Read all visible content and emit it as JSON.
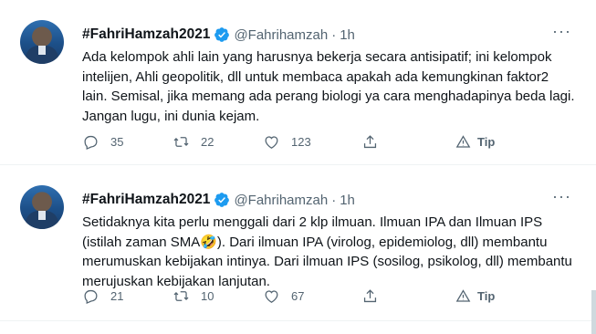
{
  "tweets": [
    {
      "display_name": "#FahriHamzah2021",
      "handle": "@Fahrihamzah",
      "separator": "·",
      "time": "1h",
      "more": "···",
      "text": "Ada kelompok ahli lain yang harusnya bekerja secara antisipatif; ini kelompok intelijen, Ahli geopolitik, dll untuk membaca apakah ada kemungkinan faktor2 lain. Semisal, jika memang ada perang biologi ya cara menghadapinya beda lagi. Jangan lugu, ini dunia kejam.",
      "replies": "35",
      "retweets": "22",
      "likes": "123",
      "tip_label": "Tip"
    },
    {
      "display_name": "#FahriHamzah2021",
      "handle": "@Fahrihamzah",
      "separator": "·",
      "time": "1h",
      "more": "···",
      "text": "Setidaknya kita perlu menggali dari 2 klp ilmuan. Ilmuan IPA dan Ilmuan IPS (istilah zaman SMA🤣). Dari ilmuan IPA (virolog, epidemiolog, dll) membantu merumuskan kebijakan intinya. Dari ilmuan IPS (sosilog, psikolog, dll) membantu merujuskan kebijakan lanjutan.",
      "replies": "21",
      "retweets": "10",
      "likes": "67",
      "tip_label": "Tip"
    }
  ],
  "colors": {
    "text": "#0f1419",
    "secondary": "#536471",
    "verified": "#1d9bf0",
    "divider": "#eff3f4"
  }
}
